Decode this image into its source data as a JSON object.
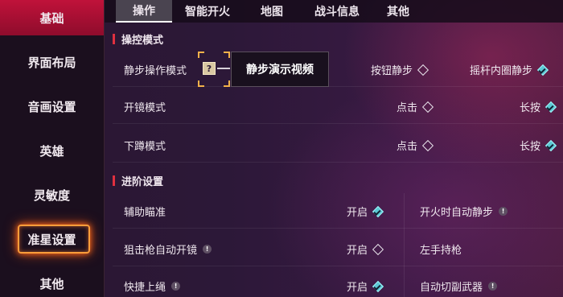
{
  "sidebar": {
    "items": [
      {
        "label": "基础",
        "state": "active"
      },
      {
        "label": "界面布局"
      },
      {
        "label": "音画设置"
      },
      {
        "label": "英雄"
      },
      {
        "label": "灵敏度"
      },
      {
        "label": "准星设置",
        "state": "highlighted"
      },
      {
        "label": "其他"
      }
    ]
  },
  "tabs": [
    {
      "label": "操作",
      "active": true
    },
    {
      "label": "智能开火"
    },
    {
      "label": "地图"
    },
    {
      "label": "战斗信息"
    },
    {
      "label": "其他"
    }
  ],
  "section_control": {
    "title": "操控模式",
    "rows": [
      {
        "label": "静步操作模式",
        "help_icon": "?",
        "tooltip": "静步演示视频",
        "options": [
          {
            "label": "按钮静步",
            "checked": false
          },
          {
            "label": "摇杆内圈静步",
            "checked": true
          }
        ]
      },
      {
        "label": "开镜模式",
        "options": [
          {
            "label": "点击",
            "checked": false
          },
          {
            "label": "长按",
            "checked": true
          }
        ]
      },
      {
        "label": "下蹲模式",
        "options": [
          {
            "label": "点击",
            "checked": false
          },
          {
            "label": "长按",
            "checked": true
          }
        ]
      }
    ]
  },
  "section_advanced": {
    "title": "进阶设置",
    "left": [
      {
        "label": "辅助瞄准",
        "warn": false,
        "value": "开启",
        "checked": true
      },
      {
        "label": "狙击枪自动开镜",
        "warn": true,
        "value": "开启",
        "checked": false
      },
      {
        "label": "快捷上绳",
        "warn": true,
        "value": "开启",
        "checked": true
      }
    ],
    "right": [
      {
        "label": "开火时自动静步",
        "warn": true
      },
      {
        "label": "左手持枪",
        "warn": false
      },
      {
        "label": "自动切副武器",
        "warn": true
      }
    ]
  },
  "icons": {
    "warn": "!",
    "help": "?"
  },
  "colors": {
    "accent_red": "#c0123a",
    "check_cyan": "#5cc8d4",
    "highlight_orange": "#ff9d3a"
  }
}
